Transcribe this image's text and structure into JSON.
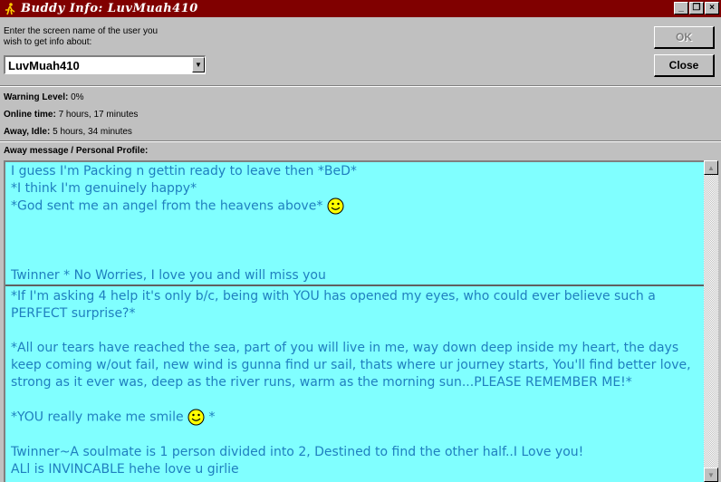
{
  "window": {
    "title": "Buddy Info: LuvMuah410",
    "controls": {
      "minimize": "_",
      "restore": "❐",
      "close": "×"
    }
  },
  "lookup": {
    "prompt_line1": "Enter the screen name of the user you",
    "prompt_line2": "wish to get info about:",
    "screen_name": "LuvMuah410"
  },
  "buttons": {
    "ok": "OK",
    "close": "Close"
  },
  "status": {
    "warning_label": "Warning Level:",
    "warning_value": " 0%",
    "online_label": "Online time:",
    "online_value": " 7 hours, 17 minutes",
    "away_label": "Away, Idle:",
    "away_value": " 5 hours, 34 minutes"
  },
  "profile_label": "Away message / Personal Profile:",
  "away_message": {
    "line1": "I guess I'm Packing n gettin ready to leave then *BeD*",
    "line2": "*I think I'm genuinely happy*",
    "line3": "*God sent me an angel from the heavens above* ",
    "line4": "Twinner * No Worries, I love you and will miss you"
  },
  "profile": {
    "para1": "*If I'm asking 4 help it's only b/c, being with YOU has opened my eyes, who could ever believe such a PERFECT surprise?*",
    "para2": "*All our tears have reached the sea, part of you will live in me, way down deep inside my heart, the days keep coming w/out fail, new wind is gunna find ur sail, thats where ur journey starts, You'll find better love, strong as it ever was, deep as the river runs, warm as the morning sun...PLEASE REMEMBER ME!*",
    "para3_before": "*YOU really make me smile ",
    "para3_after": " *",
    "para4": "Twinner~A soulmate is 1 person divided into 2, Destined to find the other half..I Love you!",
    "para5": "ALl is INVINCABLE hehe love u girlie"
  },
  "colors": {
    "titlebar": "#800000",
    "profile_bg": "#80ffff",
    "profile_text": "#1f7fbf"
  }
}
